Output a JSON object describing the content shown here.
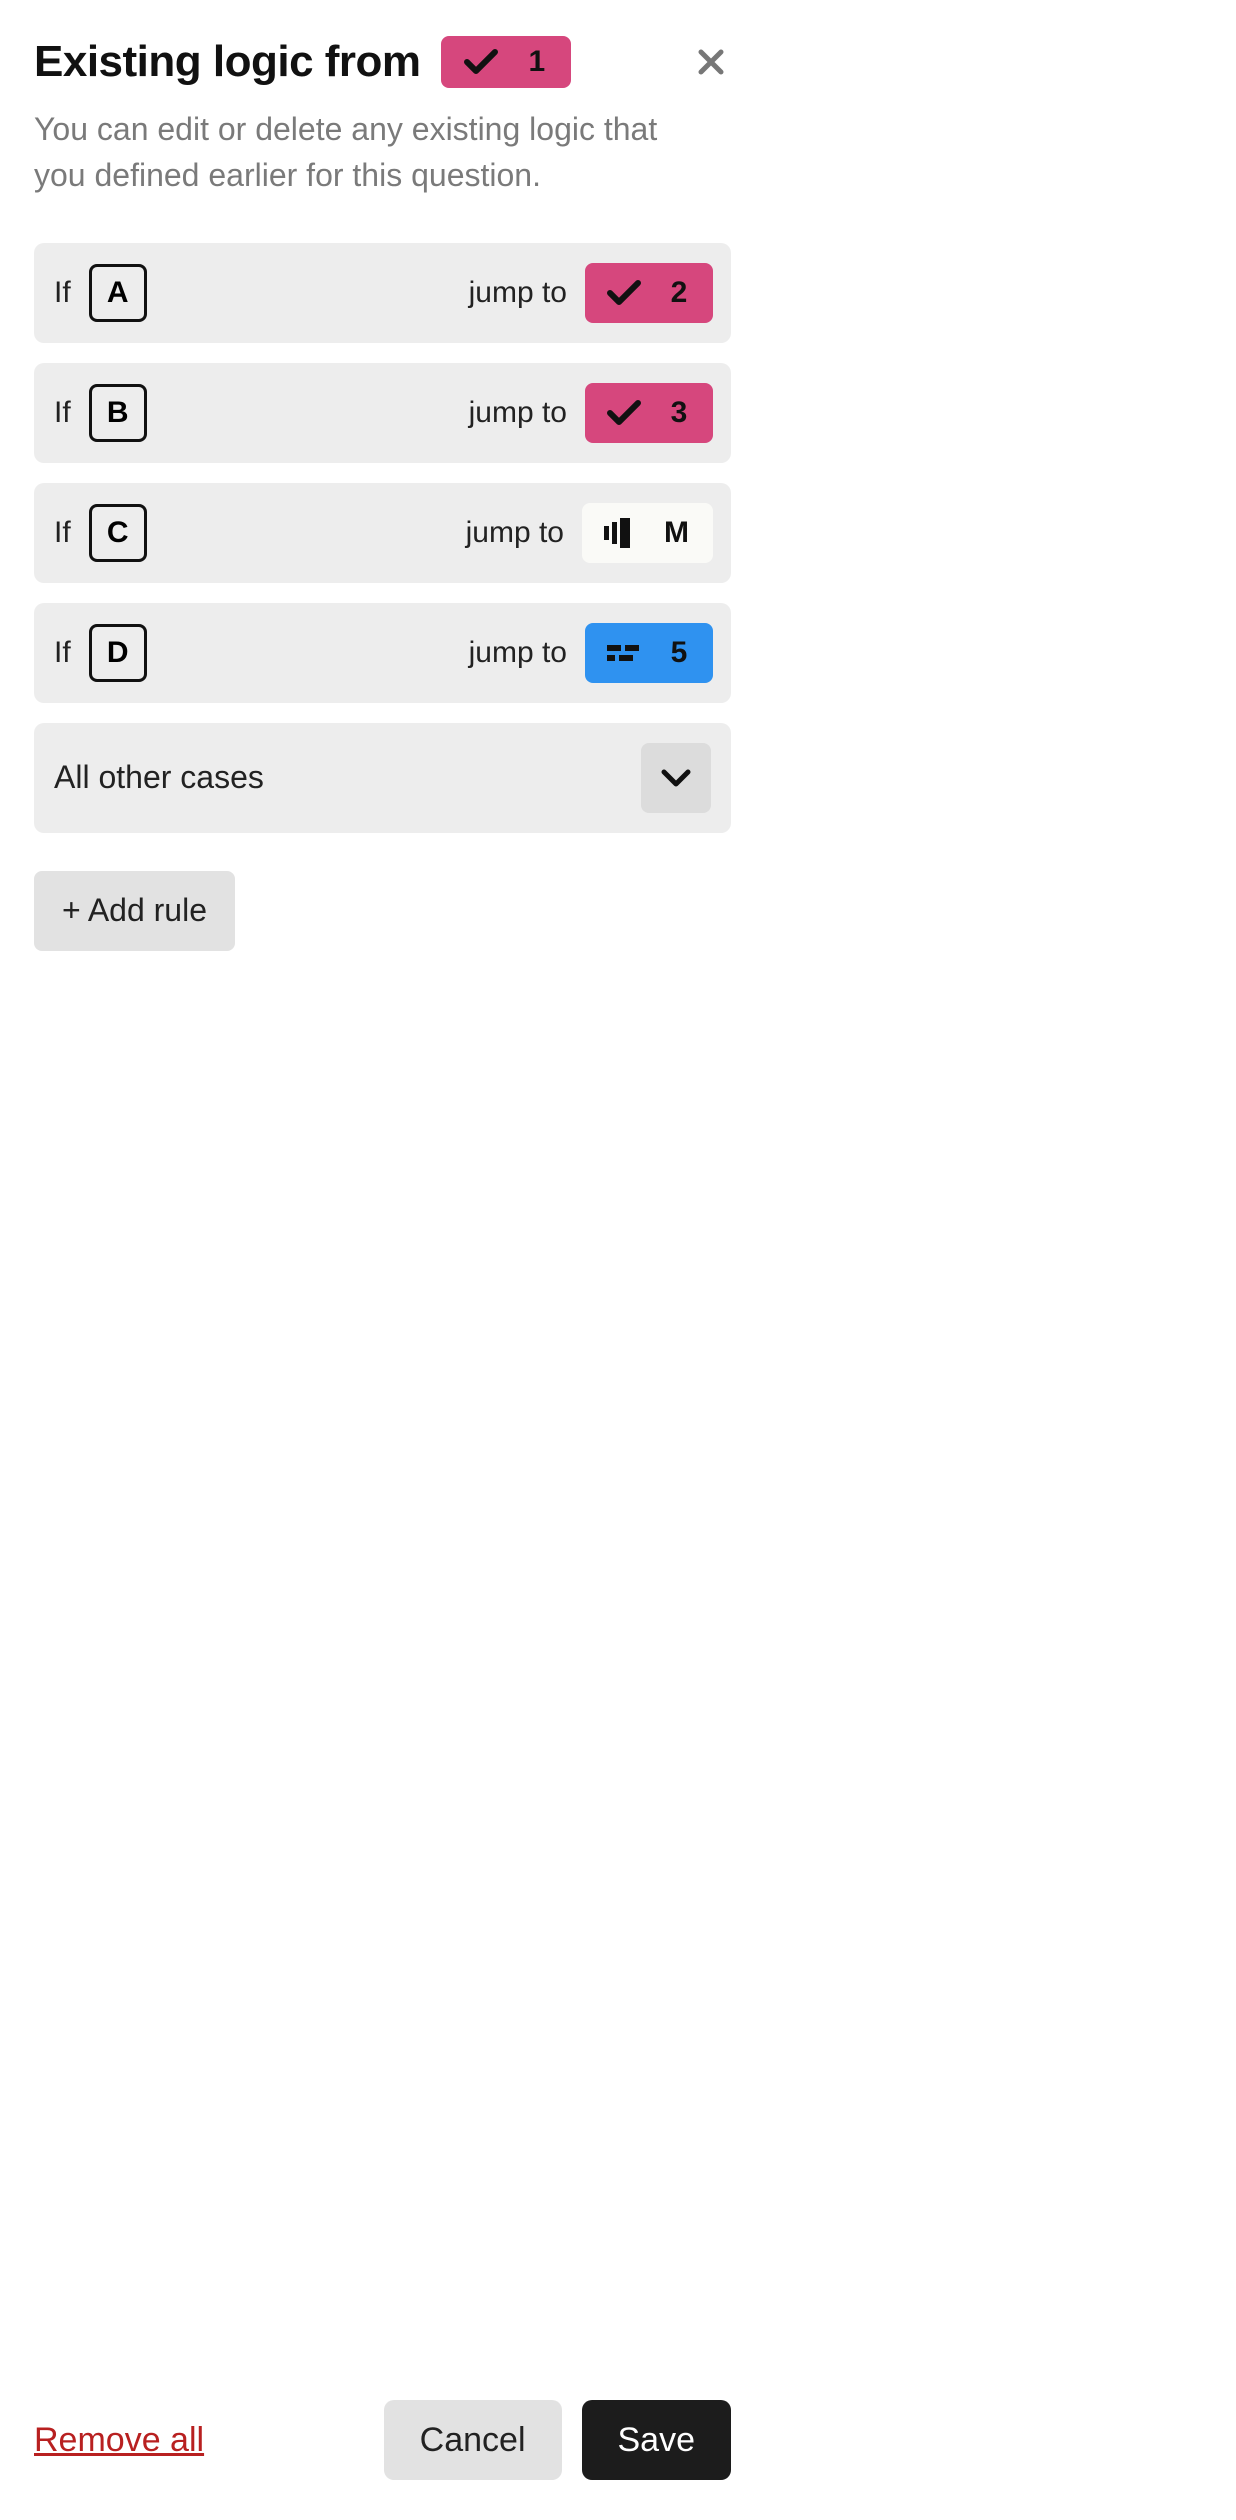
{
  "header": {
    "title": "Existing logic from",
    "source_badge": {
      "icon": "check",
      "number": "1",
      "color": "pink"
    }
  },
  "subtitle": "You can edit or delete any existing logic that you defined earlier for this question.",
  "rules": [
    {
      "if_label": "If",
      "letter": "A",
      "jump_label": "jump to",
      "target": {
        "icon": "check",
        "value": "2",
        "color": "pink"
      }
    },
    {
      "if_label": "If",
      "letter": "B",
      "jump_label": "jump to",
      "target": {
        "icon": "check",
        "value": "3",
        "color": "pink"
      }
    },
    {
      "if_label": "If",
      "letter": "C",
      "jump_label": "jump to",
      "target": {
        "icon": "bars",
        "value": "M",
        "color": "white"
      }
    },
    {
      "if_label": "If",
      "letter": "D",
      "jump_label": "jump to",
      "target": {
        "icon": "dashes",
        "value": "5",
        "color": "blue"
      }
    }
  ],
  "all_other_cases_label": "All other cases",
  "add_rule_label": "+ Add rule",
  "footer": {
    "remove_all_label": "Remove all",
    "cancel_label": "Cancel",
    "save_label": "Save"
  }
}
